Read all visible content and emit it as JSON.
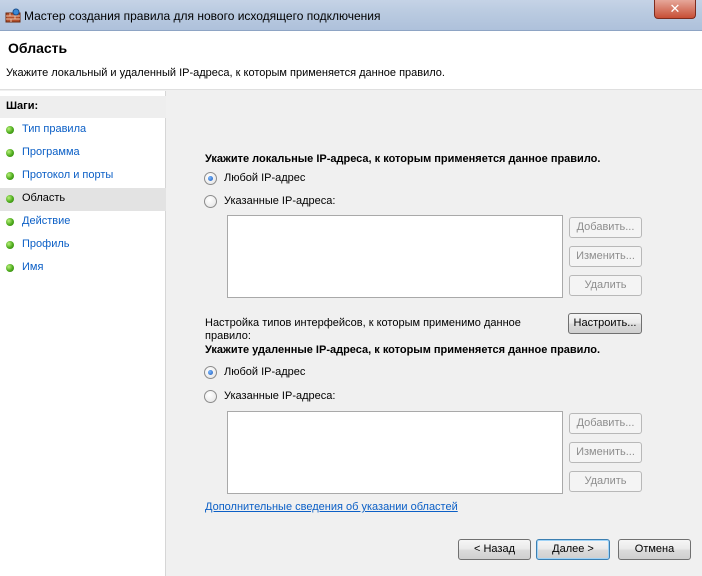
{
  "window": {
    "title": "Мастер создания правила для нового исходящего подключения",
    "close_glyph": "✕"
  },
  "header": {
    "title": "Область",
    "description": "Укажите локальный и удаленный IP-адреса, к которым применяется данное правило."
  },
  "sidebar": {
    "title": "Шаги:",
    "items": [
      {
        "label": "Тип правила",
        "active": false
      },
      {
        "label": "Программа",
        "active": false
      },
      {
        "label": "Протокол и порты",
        "active": false
      },
      {
        "label": "Область",
        "active": true
      },
      {
        "label": "Действие",
        "active": false
      },
      {
        "label": "Профиль",
        "active": false
      },
      {
        "label": "Имя",
        "active": false
      }
    ]
  },
  "local": {
    "heading": "Укажите локальные IP-адреса, к которым применяется данное правило.",
    "any_label": "Любой IP-адрес",
    "specified_label": "Указанные IP-адреса:",
    "selected": "any",
    "add_label": "Добавить...",
    "edit_label": "Изменить...",
    "remove_label": "Удалить"
  },
  "interfaces": {
    "text": "Настройка типов интерфейсов, к которым применимо данное правило:",
    "button_label": "Настроить..."
  },
  "remote": {
    "heading": "Укажите удаленные IP-адреса, к которым применяется данное правило.",
    "any_label": "Любой IP-адрес",
    "specified_label": "Указанные IP-адреса:",
    "selected": "any",
    "add_label": "Добавить...",
    "edit_label": "Изменить...",
    "remove_label": "Удалить"
  },
  "more_info_link": "Дополнительные сведения об указании областей",
  "footer": {
    "back_label": "< Назад",
    "next_label": "Далее >",
    "cancel_label": "Отмена"
  }
}
